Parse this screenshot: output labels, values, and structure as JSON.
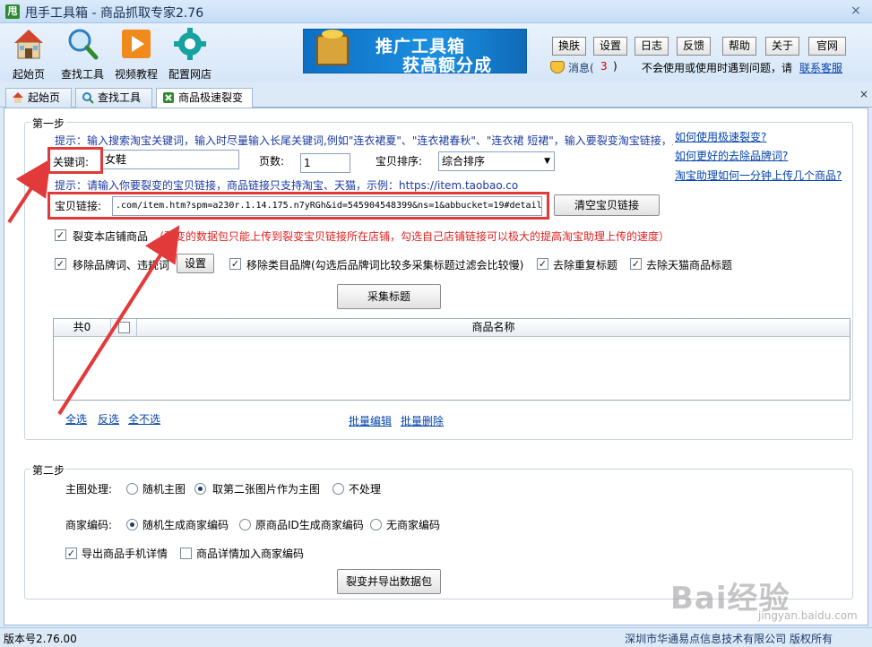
{
  "window": {
    "title": "甩手工具箱 - 商品抓取专家2.76",
    "logo_char": "甩",
    "close_glyph": "×"
  },
  "toolbar": {
    "items": [
      {
        "label": "起始页"
      },
      {
        "label": "查找工具"
      },
      {
        "label": "视频教程"
      },
      {
        "label": "配置网店"
      }
    ],
    "banner": {
      "line1": "推广工具箱",
      "line2": "获高额分成"
    },
    "buttons": [
      "换肤",
      "设置",
      "日志",
      "反馈",
      "帮助",
      "关于",
      "官网"
    ],
    "message_label": "消息(",
    "message_count": "3",
    "message_close": ")",
    "help_text": "不会使用或使用时遇到问题，请",
    "support_link": "联系客服"
  },
  "tabs": [
    {
      "label": "起始页"
    },
    {
      "label": "查找工具"
    },
    {
      "label": "商品极速裂变"
    }
  ],
  "tab_close": "×",
  "step1": {
    "title": "第一步",
    "hint1": "提示：输入搜索淘宝关键词，输入时尽量输入长尾关键词,例如\"连衣裙夏\"、\"连衣裙春秋\"、\"连衣裙 短裙\"，输入要裂变淘宝链接，点击采集标题",
    "keyword_label": "关键词:",
    "keyword_value": "女鞋",
    "pages_label": "页数:",
    "pages_value": "1",
    "sort_label": "宝贝排序:",
    "sort_value": "综合排序",
    "hint2": "提示：请输入你要裂变的宝贝链接，商品链接只支持淘宝、天猫，示例：https://item.taobao.co",
    "link_label": "宝贝链接:",
    "link_value": ".com/item.htm?spm=a230r.1.14.175.n7yRGh&id=545904548399&ns=1&abbucket=19#detail",
    "clear_link_button": "清空宝贝链接",
    "help_links": [
      "如何使用极速裂变?",
      "如何更好的去除品牌词?",
      "淘宝助理如何一分钟上传几个商品?"
    ],
    "split_shop_label": "裂变本店铺商品",
    "split_shop_warning": "（裂变的数据包只能上传到裂变宝贝链接所在店铺，勾选自己店铺链接可以极大的提高淘宝助理上传的速度）",
    "remove_brand_label": "移除品牌词、违规词",
    "settings_button": "设置",
    "remove_category_brand_label": "移除类目品牌(勾选后品牌词比较多采集标题过滤会比较慢)",
    "remove_dup_label": "去除重复标题",
    "remove_tmall_label": "去除天猫商品标题",
    "collect_button": "采集标题",
    "table": {
      "count_header": "共0",
      "name_header": "商品名称"
    },
    "select_all": "全选",
    "invert": "反选",
    "select_none": "全不选",
    "batch_edit": "批量编辑",
    "batch_delete": "批量删除"
  },
  "step2": {
    "title": "第二步",
    "main_image_label": "主图处理:",
    "main_image_options": [
      "随机主图",
      "取第二张图片作为主图",
      "不处理"
    ],
    "main_image_selected": 1,
    "merchant_code_label": "商家编码:",
    "merchant_code_options": [
      "随机生成商家编码",
      "原商品ID生成商家编码",
      "无商家编码"
    ],
    "merchant_code_selected": 0,
    "export_mobile_label": "导出商品手机详情",
    "detail_code_label": "商品详情加入商家编码",
    "export_button": "裂变并导出数据包"
  },
  "statusbar": {
    "version": "版本号2.76.00",
    "copyright": "深圳市华通易点信息技术有限公司 版权所有"
  },
  "watermark": {
    "main": "Bai经验",
    "sub": "jingyan.baidu.com"
  },
  "colors": {
    "annotation_red": "#e23a3a",
    "link_blue": "#0645ad",
    "hint_blue": "#1a3aa0",
    "warning_red": "#e02020"
  }
}
